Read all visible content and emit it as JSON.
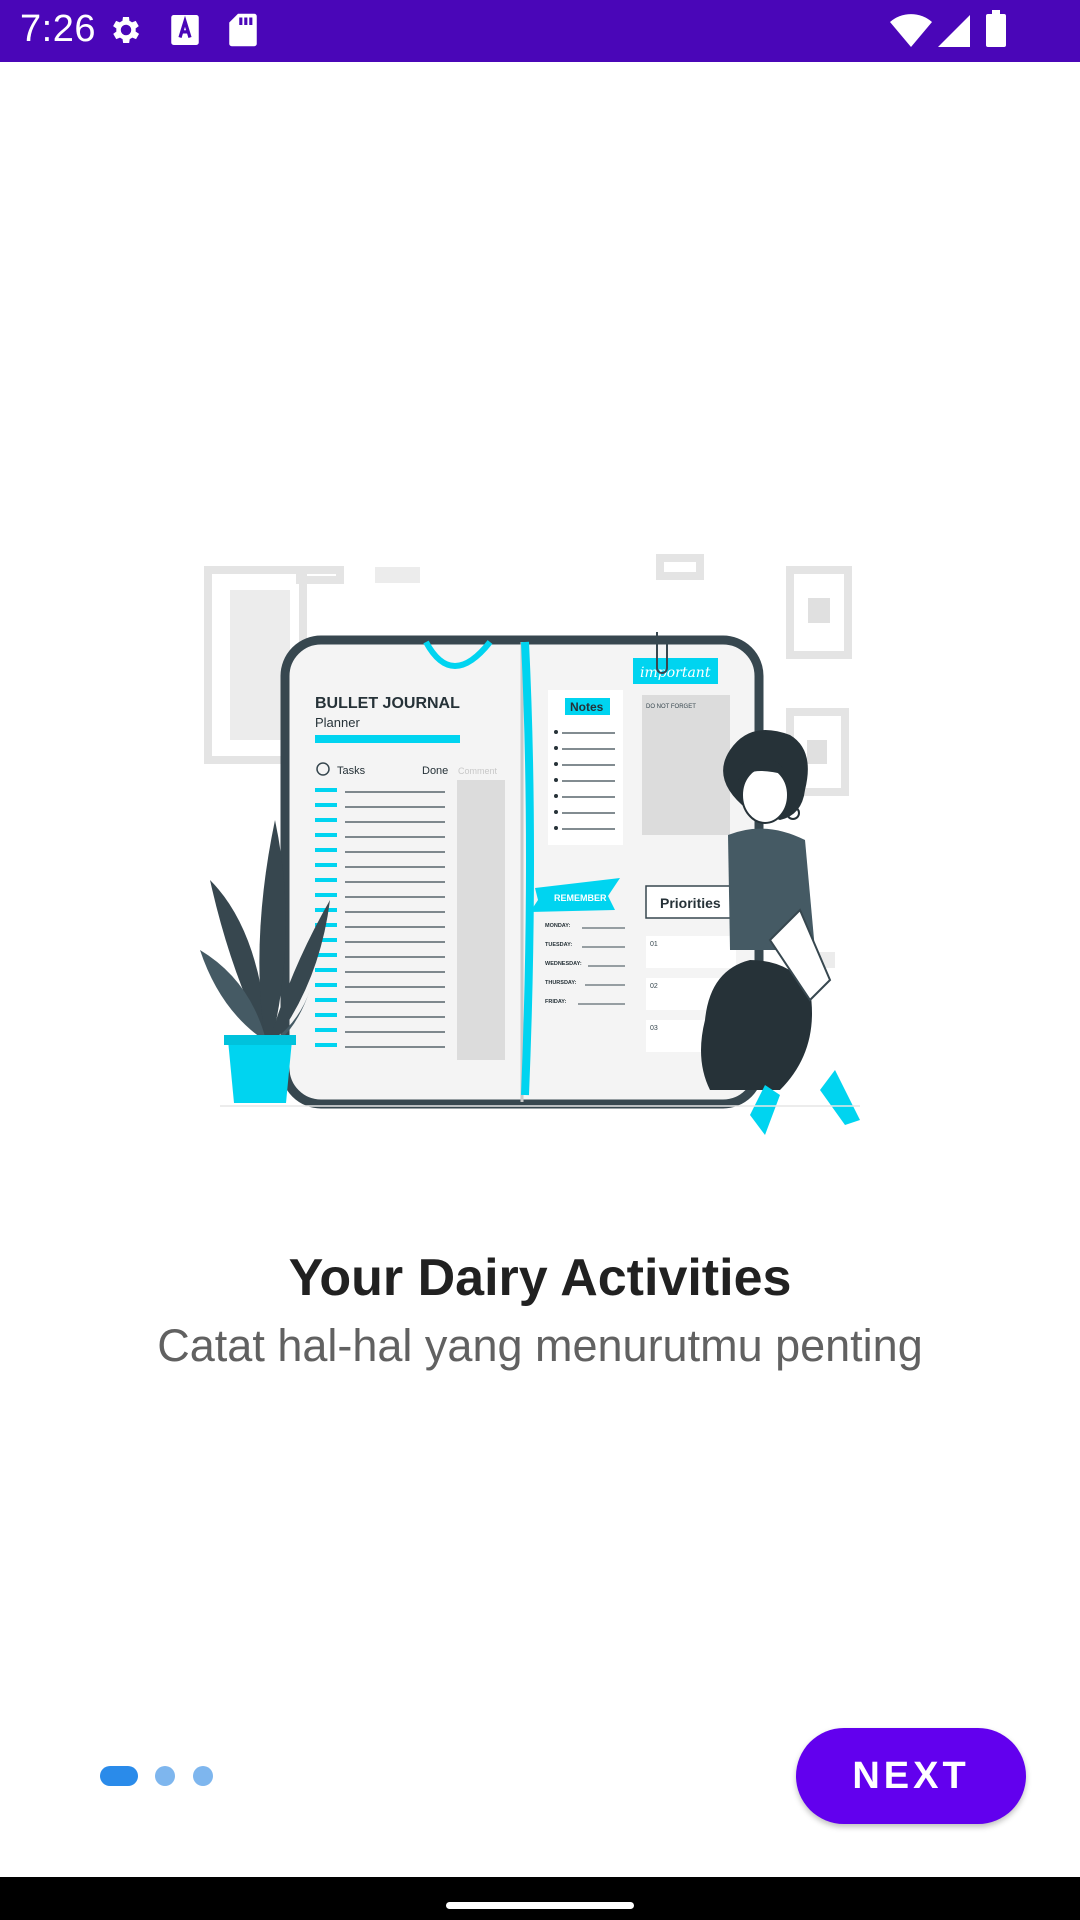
{
  "status_bar": {
    "time": "7:26",
    "icons": [
      "gear-icon",
      "text-a-icon",
      "sd-card-icon",
      "wifi-icon",
      "signal-icon",
      "battery-icon"
    ],
    "background": "#4a06b8"
  },
  "onboarding": {
    "illustration": {
      "icon": "bullet-journal-illustration",
      "journal_title": "BULLET JOURNAL",
      "journal_subtitle": "Planner",
      "tasks_label": "Tasks",
      "done_label": "Done",
      "comment_label": "Comment",
      "notes_label": "Notes",
      "important_label": "important",
      "do_not_forget_label": "DO NOT FORGET",
      "remember_label": "REMEMBER",
      "priorities_label": "Priorities",
      "days": [
        "MONDAY:",
        "TUESDAY:",
        "WEDNESDAY:",
        "THURSDAY:",
        "FRIDAY:"
      ],
      "priority_numbers": [
        "01",
        "02",
        "03"
      ]
    },
    "title": "Your Dairy Activities",
    "subtitle": "Catat hal-hal yang menurutmu penting",
    "page_indicator": {
      "current_page": 1,
      "total_pages": 3
    },
    "next_label": "NEXT",
    "accent_color": "#6200ee",
    "indicator_active_color": "#2a8bea",
    "illustration_accent_color": "#00d4f0"
  }
}
